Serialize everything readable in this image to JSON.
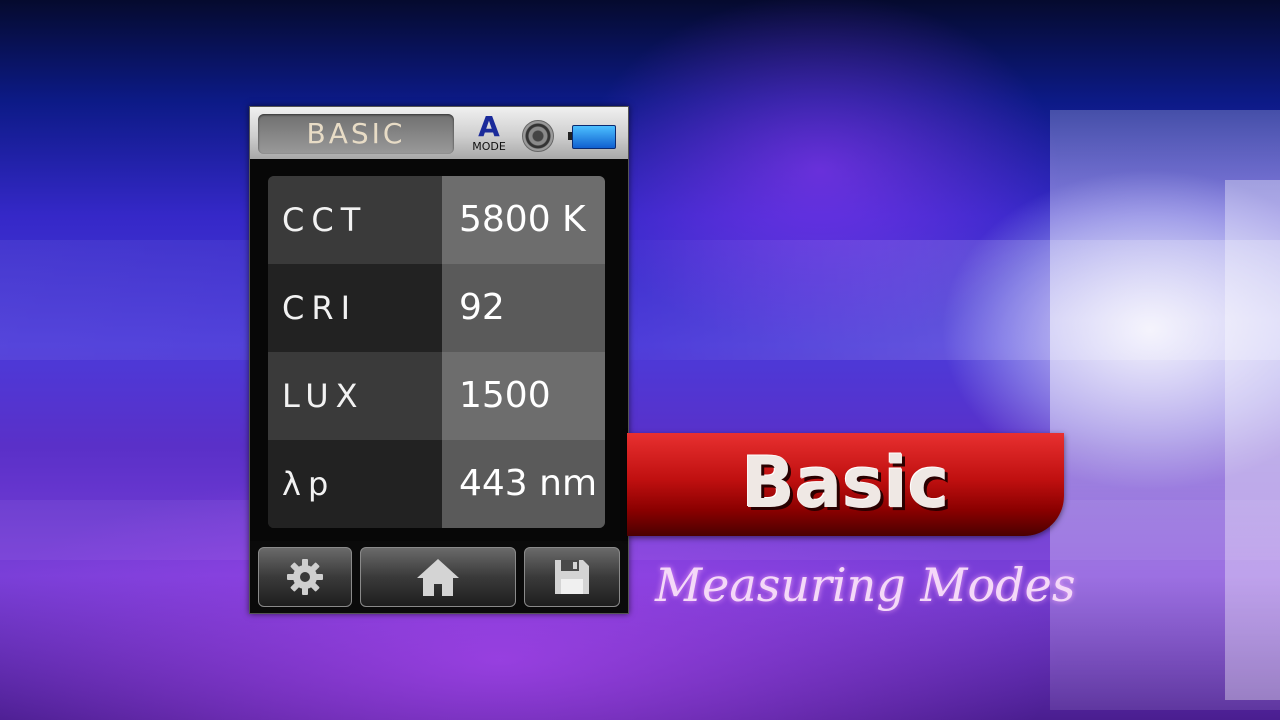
{
  "device": {
    "mode_title": "BASIC",
    "auto_mode": {
      "letter": "A",
      "label": "MODE"
    },
    "status_icons": [
      "shutter-icon",
      "battery-icon"
    ],
    "readings": [
      {
        "label": "CCT",
        "value": "5800 K"
      },
      {
        "label": "CRI",
        "value": "92"
      },
      {
        "label": "LUX",
        "value": "1500"
      },
      {
        "label": "λp",
        "value": "443 nm"
      }
    ],
    "buttons": [
      "gear-icon",
      "home-icon",
      "save-icon"
    ]
  },
  "banner": {
    "title": "Basic",
    "subtitle": "Measuring Modes"
  },
  "colors": {
    "banner_red": "#c01010",
    "battery_blue": "#1e8ae8",
    "auto_blue": "#1a2a9a"
  }
}
